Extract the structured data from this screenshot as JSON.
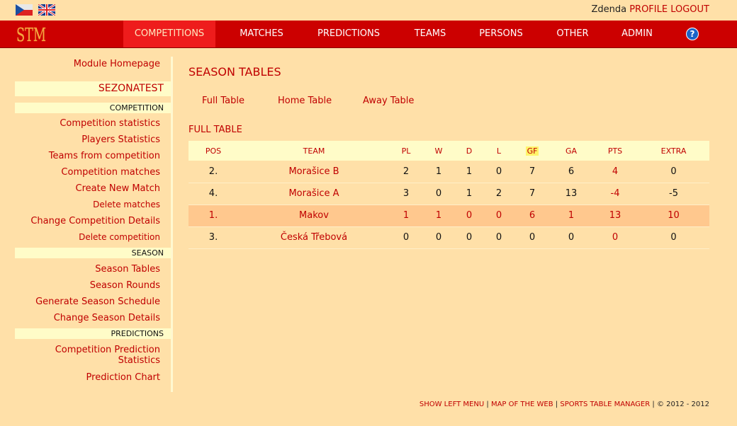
{
  "user": {
    "name": "Zdenda",
    "profile": "PROFILE",
    "logout": "LOGOUT"
  },
  "logo_text": "STM",
  "nav": {
    "competitions": "COMPETITIONS",
    "matches": "MATCHES",
    "predictions": "PREDICTIONS",
    "teams": "TEAMS",
    "persons": "PERSONS",
    "other": "OTHER",
    "admin": "ADMIN",
    "help": "?"
  },
  "leftmenu": {
    "module_homepage": "Module Homepage",
    "season_name": "SEZONATEST",
    "competition_header": "COMPETITION",
    "competition_statistics": "Competition statistics",
    "players_statistics": "Players Statistics",
    "teams_from_competition": "Teams from competition",
    "competition_matches": "Competition matches",
    "create_new_match": "Create New Match",
    "delete_matches": "Delete matches",
    "change_competition_details": "Change Competition Details",
    "delete_competition": "Delete competition",
    "season_header": "SEASON",
    "season_tables": "Season Tables",
    "season_rounds": "Season Rounds",
    "generate_season_schedule": "Generate Season Schedule",
    "change_season_details": "Change Season Details",
    "predictions_header": "PREDICTIONS",
    "competition_prediction_line1": "Competition Prediction",
    "competition_prediction_line2": "Statistics",
    "prediction_chart": "Prediction Chart"
  },
  "main": {
    "title": "SEASON TABLES",
    "tabs": {
      "full": "Full Table",
      "home": "Home Table",
      "away": "Away Table"
    },
    "section_title": "FULL TABLE"
  },
  "table": {
    "headers": {
      "pos": "POS",
      "team": "TEAM",
      "pl": "PL",
      "w": "W",
      "d": "D",
      "l": "L",
      "gf": "GF",
      "ga": "GA",
      "pts": "PTS",
      "extra": "EXTRA"
    },
    "rows": [
      {
        "pos": "2.",
        "team": "Morašice B",
        "pl": "2",
        "w": "1",
        "d": "1",
        "l": "0",
        "gf": "7",
        "ga": "6",
        "pts": "4",
        "extra": "0"
      },
      {
        "pos": "4.",
        "team": "Morašice A",
        "pl": "3",
        "w": "0",
        "d": "1",
        "l": "2",
        "gf": "7",
        "ga": "13",
        "pts": "-4",
        "extra": "-5"
      },
      {
        "pos": "1.",
        "team": "Makov",
        "pl": "1",
        "w": "1",
        "d": "0",
        "l": "0",
        "gf": "6",
        "ga": "1",
        "pts": "13",
        "extra": "10"
      },
      {
        "pos": "3.",
        "team": "Česká Třebová",
        "pl": "0",
        "w": "0",
        "d": "0",
        "l": "0",
        "gf": "0",
        "ga": "0",
        "pts": "0",
        "extra": "0"
      }
    ]
  },
  "footer": {
    "show_left_menu": "SHOW LEFT MENU",
    "map_of_web": "MAP OF THE WEB",
    "sports_table_manager": "SPORTS TABLE MANAGER",
    "separator": "|",
    "copyright": "© 2012 - 2012"
  },
  "colors": {
    "background": "#ffe0a8",
    "nav_red": "#cc0000",
    "accent": "#c00000",
    "highlight_row": "#ffc88e",
    "menu_section": "#fffcc8"
  }
}
